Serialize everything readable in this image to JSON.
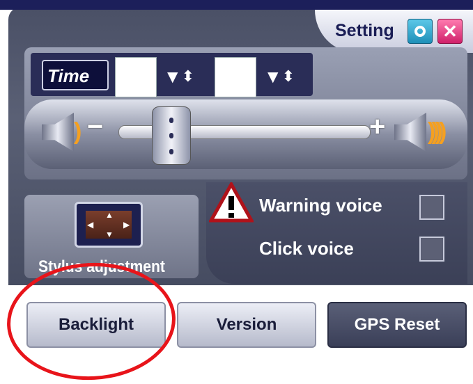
{
  "header": {
    "title": "Setting"
  },
  "time": {
    "label": "Time",
    "hour_value": "",
    "minute_value": ""
  },
  "volume": {
    "minus": "−",
    "plus": "+",
    "level": 0.2
  },
  "stylus": {
    "label": "Stylus adjustment"
  },
  "voice": {
    "warning_label": "Warning voice",
    "warning_checked": false,
    "click_label": "Click voice",
    "click_checked": false
  },
  "buttons": {
    "backlight": "Backlight",
    "version": "Version",
    "gps_reset": "GPS Reset"
  },
  "colors": {
    "panel": "#4a5066",
    "accent_ok": "#1e8fb8",
    "accent_close": "#d0206a",
    "annotation": "#e8141a",
    "title_text": "#1a1d55"
  },
  "icons": [
    "ok-icon",
    "close-icon",
    "speaker-low-icon",
    "speaker-high-icon",
    "warning-icon",
    "stylus-crosshair-icon"
  ]
}
